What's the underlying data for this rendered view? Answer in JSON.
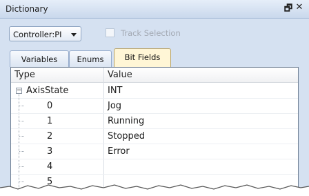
{
  "window": {
    "title": "Dictionary",
    "float_icon": "float-window-icon",
    "close_icon": "close-icon"
  },
  "toolbar": {
    "controller_select": "Controller:PI",
    "track_selection_label": "Track Selection",
    "track_selection_checked": false
  },
  "tabs": [
    {
      "label": "Variables",
      "active": false
    },
    {
      "label": "Enums",
      "active": false
    },
    {
      "label": "Bit Fields",
      "active": true
    }
  ],
  "grid": {
    "columns": [
      "Type",
      "Value"
    ],
    "parent": {
      "type": "AxisState",
      "value": "INT",
      "expanded": true
    },
    "children": [
      {
        "bit": "0",
        "value": "Jog"
      },
      {
        "bit": "1",
        "value": "Running"
      },
      {
        "bit": "2",
        "value": "Stopped"
      },
      {
        "bit": "3",
        "value": "Error"
      },
      {
        "bit": "4",
        "value": ""
      },
      {
        "bit": "5",
        "value": ""
      }
    ]
  },
  "colors": {
    "active_tab": "#fff6d6",
    "panel_bg": "#d5e1f1"
  }
}
